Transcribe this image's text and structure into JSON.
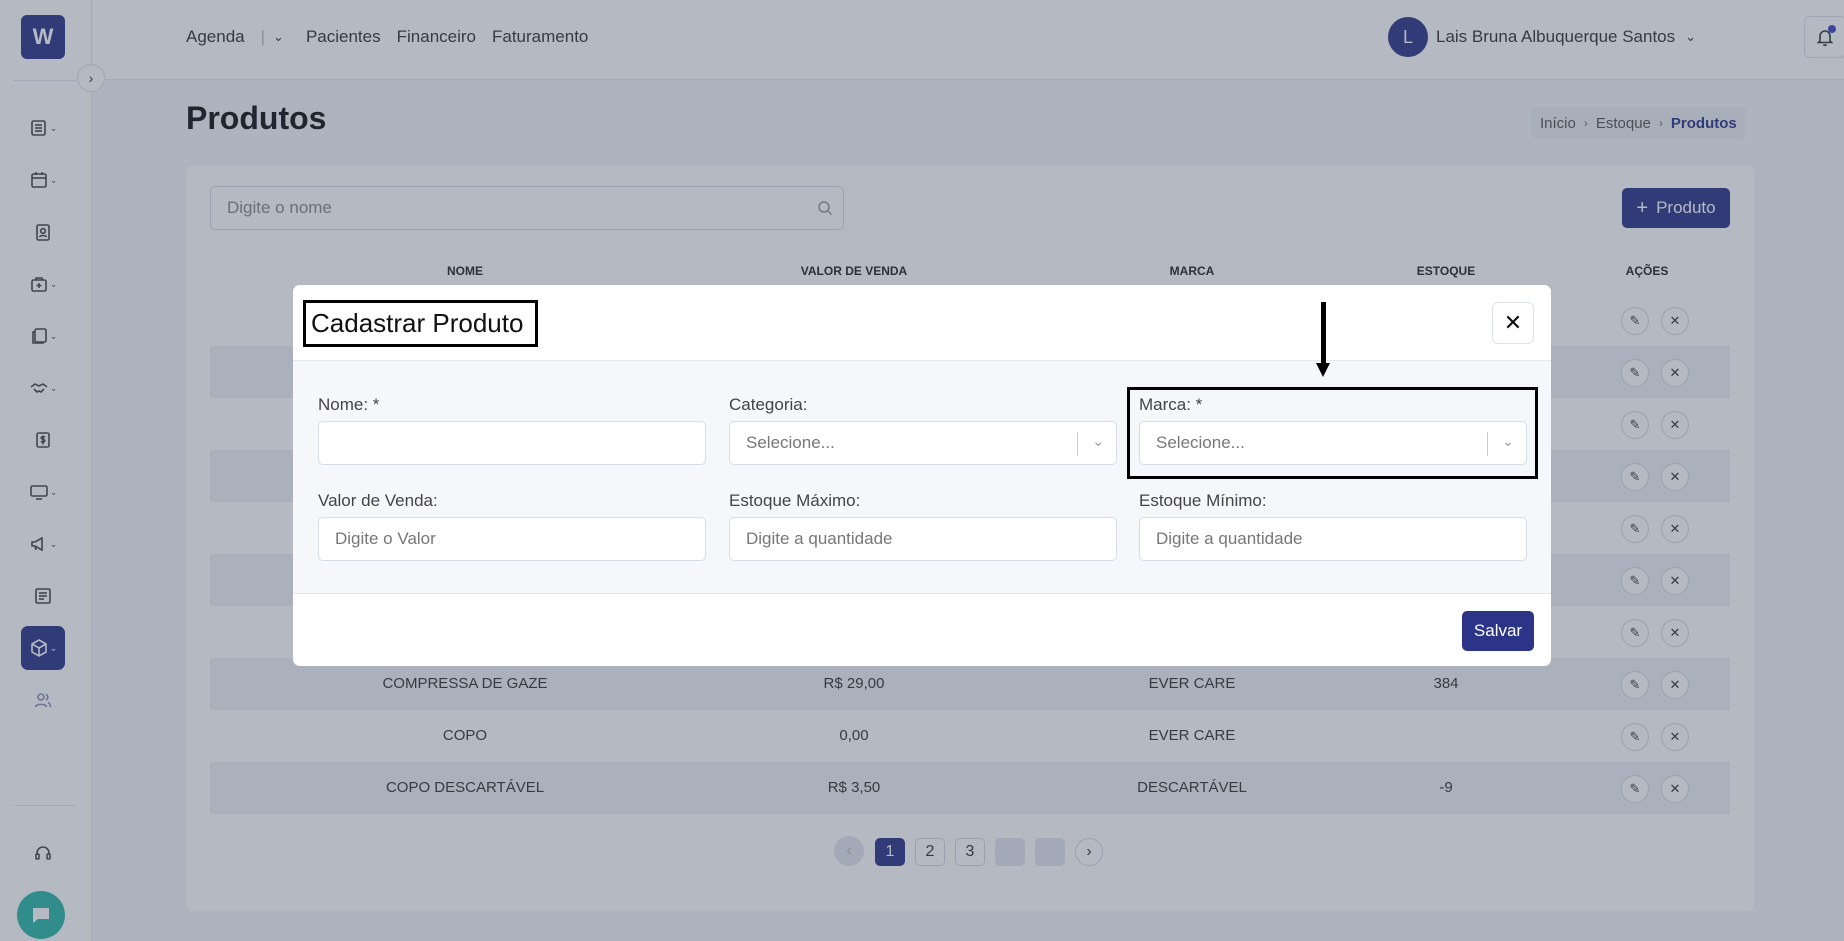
{
  "app": {
    "logo_text": "W",
    "brand_color": "#2b3487"
  },
  "nav": {
    "items": [
      "Agenda",
      "Pacientes",
      "Financeiro",
      "Faturamento"
    ]
  },
  "user": {
    "initial": "L",
    "name": "Lais Bruna Albuquerque Santos"
  },
  "page": {
    "title": "Produtos"
  },
  "breadcrumb": [
    "Início",
    "Estoque",
    "Produtos"
  ],
  "search": {
    "placeholder": "Digite o nome"
  },
  "add_button": {
    "label": "Produto"
  },
  "table": {
    "headers": [
      "NOME",
      "VALOR DE VENDA",
      "MARCA",
      "ESTOQUE",
      "AÇÕES"
    ],
    "rows": [
      {
        "nome": "COMPRESSA DE GAZE",
        "valor": "R$ 29,00",
        "marca": "EVER CARE",
        "estoque": "384"
      },
      {
        "nome": "COPO",
        "valor": "0,00",
        "marca": "EVER CARE",
        "estoque": ""
      },
      {
        "nome": "COPO DESCARTÁVEL",
        "valor": "R$ 3,50",
        "marca": "DESCARTÁVEL",
        "estoque": "-9"
      }
    ]
  },
  "pagination": {
    "pages": [
      "1",
      "2",
      "3"
    ],
    "current": "1"
  },
  "modal": {
    "title": "Cadastrar Produto",
    "fields": {
      "nome": {
        "label": "Nome: *",
        "value": ""
      },
      "categoria": {
        "label": "Categoria:",
        "placeholder": "Selecione..."
      },
      "marca": {
        "label": "Marca: *",
        "placeholder": "Selecione..."
      },
      "valor_venda": {
        "label": "Valor de Venda:",
        "placeholder": "Digite o Valor"
      },
      "estoque_maximo": {
        "label": "Estoque Máximo:",
        "placeholder": "Digite a quantidade"
      },
      "estoque_minimo": {
        "label": "Estoque Mínimo:",
        "placeholder": "Digite a quantidade"
      }
    },
    "save_label": "Salvar"
  }
}
